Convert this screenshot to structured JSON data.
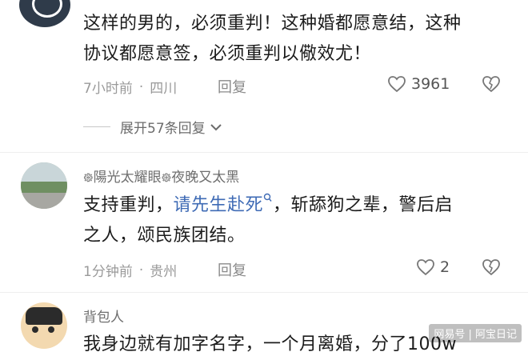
{
  "comments": [
    {
      "text_line1": "这样的男的，必须重判！这种婚都愿意结，这种",
      "text_line2": "协议都愿意签，必须重判以儆效尤！",
      "time": "7小时前",
      "location": "四川",
      "reply_label": "回复",
      "like_count": "3961",
      "expand_label": "展开57条回复"
    },
    {
      "username": "᪥陽光太耀眼᪥夜晚又太黑",
      "text_prefix": "支持重判，",
      "text_link": "请先生赴死",
      "text_suffix": "，斩舔狗之辈，警后启",
      "text_line2": "之人，颂民族团结。",
      "time": "1分钟前",
      "location": "贵州",
      "reply_label": "回复",
      "like_count": "2"
    },
    {
      "username": "背包人",
      "text_line1": "我身边就有加字名字，一个月离婚，分了100w"
    }
  ],
  "watermark": "网易号 | 阿宝日记",
  "colors": {
    "link": "#3f6bb5",
    "meta": "#9a9a9a",
    "text": "#1c1c1c"
  },
  "icons": [
    "like-heart-icon",
    "dislike-heart-icon",
    "chevron-down-icon",
    "search-suffix-icon"
  ]
}
